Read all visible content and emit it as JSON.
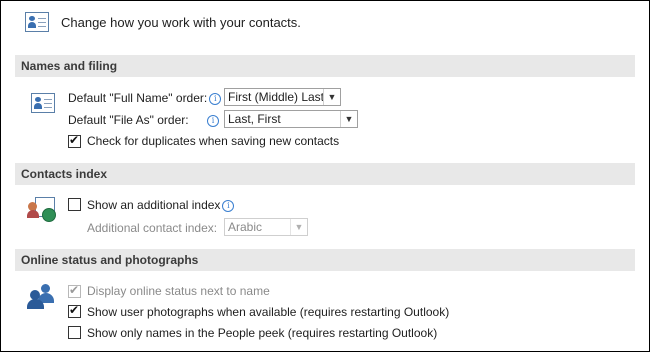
{
  "header": {
    "title": "Change how you work with your contacts.",
    "icon": "contact-card-icon"
  },
  "names_filing": {
    "heading": "Names and filing",
    "full_name_label": "Default \"Full Name\" order:",
    "full_name_value": "First (Middle) Last",
    "file_as_label": "Default \"File As\" order:",
    "file_as_value": "Last, First",
    "duplicates_label": "Check for duplicates when saving new contacts",
    "duplicates_checked": true
  },
  "contacts_index": {
    "heading": "Contacts index",
    "show_index_label": "Show an additional index",
    "show_index_checked": false,
    "additional_label": "Additional contact index:",
    "additional_value": "Arabic"
  },
  "online_status": {
    "heading": "Online status and photographs",
    "display_status_label": "Display online status next to name",
    "display_status_checked": true,
    "show_photos_label": "Show user photographs when available (requires restarting Outlook)",
    "show_photos_checked": true,
    "show_names_label": "Show only names in the People peek (requires restarting Outlook)",
    "show_names_checked": false
  }
}
